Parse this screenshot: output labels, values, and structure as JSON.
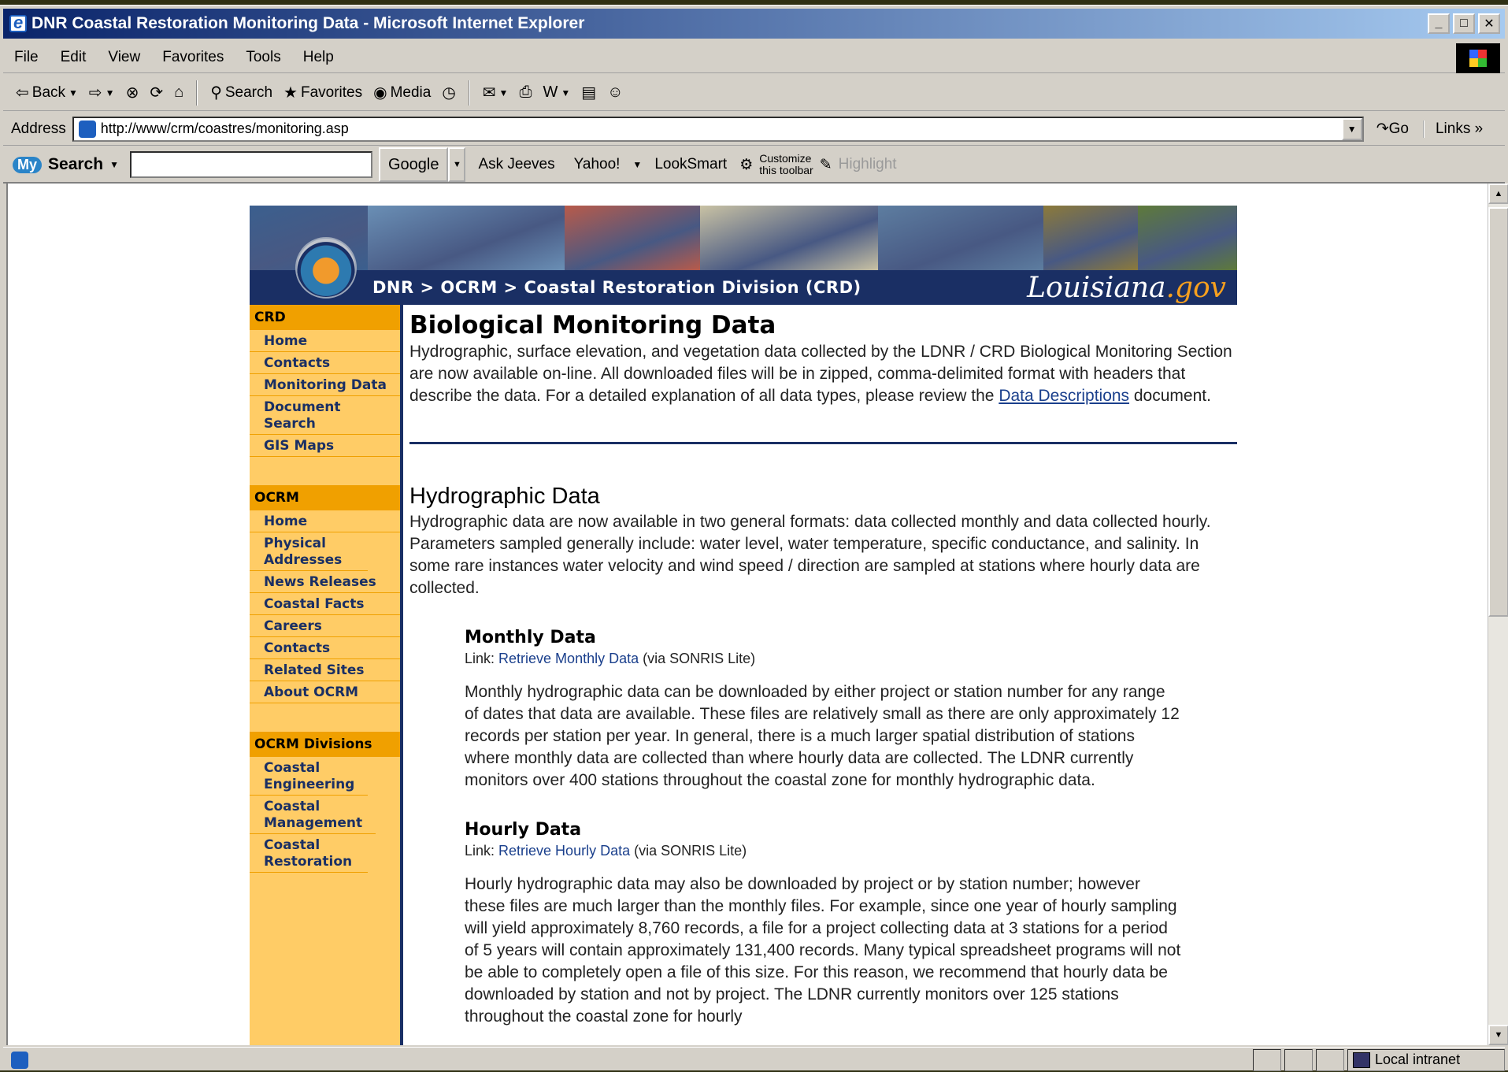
{
  "window": {
    "title": "DNR Coastal Restoration Monitoring Data - Microsoft Internet Explorer",
    "min": "_",
    "max": "□",
    "close": "✕"
  },
  "menu": [
    "File",
    "Edit",
    "View",
    "Favorites",
    "Tools",
    "Help"
  ],
  "toolbar": {
    "back": "Back",
    "search": "Search",
    "favorites": "Favorites",
    "media": "Media"
  },
  "address": {
    "label": "Address",
    "url": "http://www/crm/coastres/monitoring.asp",
    "go": "Go",
    "links": "Links"
  },
  "searchbar": {
    "my": "My",
    "search": "Search",
    "google": "Google",
    "ask": "Ask Jeeves",
    "yahoo": "Yahoo!",
    "looksmart": "LookSmart",
    "customize1": "Customize",
    "customize2": "this toolbar",
    "highlight": "Highlight"
  },
  "banner": {
    "breadcrumb": "DNR > OCRM > Coastal Restoration Division (CRD)",
    "logo_main": "Louisiana",
    "logo_dot": ".gov",
    "photo_colors": [
      "#3b5f8e",
      "#6a8fb5",
      "#b85a4a",
      "#c9c2a4",
      "#5d7da0",
      "#8c7a3a",
      "#5e7a3a"
    ]
  },
  "sidebar": {
    "crd": {
      "head": "CRD",
      "items": [
        "Home",
        "Contacts",
        "Monitoring Data",
        "Document Search",
        "GIS Maps"
      ]
    },
    "ocrm": {
      "head": "OCRM",
      "items": [
        "Home",
        "Physical Addresses",
        "News Releases",
        "Coastal Facts",
        "Careers",
        "Contacts",
        "Related Sites",
        "About OCRM"
      ]
    },
    "div": {
      "head": "OCRM Divisions",
      "items": [
        "Coastal Engineering",
        "Coastal Management",
        "Coastal Restoration"
      ]
    }
  },
  "main": {
    "title": "Biological Monitoring Data",
    "intro_pre": "Hydrographic, surface elevation, and vegetation data collected by the LDNR / CRD Biological Monitoring Section are now available on-line. All downloaded files will be in zipped, comma-delimited format with headers that describe the data. For a detailed explanation of all data types, please review the ",
    "intro_link": "Data Descriptions",
    "intro_post": " document.",
    "hydro_title": "Hydrographic Data",
    "hydro_body": "Hydrographic data are now available in two general formats: data collected monthly and data collected hourly. Parameters sampled generally include: water level, water temperature, specific conductance, and salinity. In some rare instances water velocity and wind speed / direction are sampled at stations where hourly data are collected.",
    "monthly": {
      "title": "Monthly Data",
      "link_pre": "Link: ",
      "link": "Retrieve Monthly Data",
      "link_post": " (via SONRIS Lite)",
      "body": "Monthly hydrographic data can be downloaded by either project or station number for any range of dates that data are available. These files are relatively small as there are only approximately 12 records per station per year. In general, there is a much larger spatial distribution of stations where monthly data are collected than where hourly data are collected. The LDNR currently monitors over 400 stations throughout the coastal zone for monthly hydrographic data."
    },
    "hourly": {
      "title": "Hourly Data",
      "link_pre": "Link: ",
      "link": "Retrieve Hourly Data",
      "link_post": " (via SONRIS Lite)",
      "body": "Hourly hydrographic data may also be downloaded by project or by station number; however these files are much larger than the monthly files. For example, since one year of hourly sampling will yield approximately 8,760 records, a file for a project collecting data at 3 stations for a period of 5 years will contain approximately 131,400 records. Many typical spreadsheet programs will not be able to completely open a file of this size. For this reason, we recommend that hourly data be downloaded by station and not by project. The LDNR currently monitors over 125 stations throughout the coastal zone for hourly"
    }
  },
  "status": {
    "zone": "Local intranet"
  }
}
